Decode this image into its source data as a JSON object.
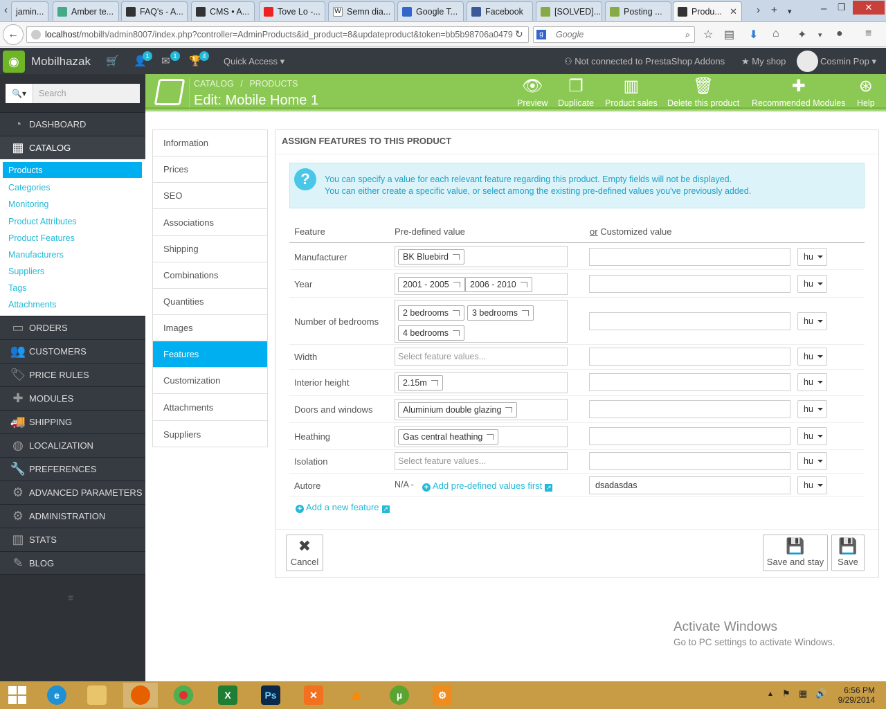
{
  "browser": {
    "tabs": [
      {
        "label": "jamin...",
        "color": "#7a8"
      },
      {
        "label": "Amber te...",
        "color": "#4a8"
      },
      {
        "label": "FAQ's - A...",
        "color": "#333"
      },
      {
        "label": "CMS • A...",
        "color": "#333"
      },
      {
        "label": "Tove Lo -...",
        "color": "#e22"
      },
      {
        "label": "Semn dia...",
        "color": "#111"
      },
      {
        "label": "Google T...",
        "color": "#36c"
      },
      {
        "label": "Facebook",
        "color": "#3b5998"
      },
      {
        "label": "[SOLVED]...",
        "color": "#8a4"
      },
      {
        "label": "Posting ...",
        "color": "#8a4"
      },
      {
        "label": "Produ...",
        "color": "#333"
      }
    ],
    "url_host": "localhost",
    "url_rest": "/mobilh/admin8007/index.php?controller=AdminProducts&id_product=8&updateproduct&token=bb5b98706a0479",
    "search_placeholder": "Google"
  },
  "header": {
    "shop_name": "Mobilhazak",
    "badges": [
      "1",
      "1",
      "4"
    ],
    "quick_access": "Quick Access",
    "addons_status": "Not connected to PrestaShop Addons",
    "my_shop": "My shop",
    "user_name": "Cosmin Pop"
  },
  "toolbar": {
    "breadcrumb_1": "CATALOG",
    "breadcrumb_sep": "/",
    "breadcrumb_2": "PRODUCTS",
    "title": "Edit: Mobile Home 1",
    "buttons": [
      "Preview",
      "Duplicate",
      "Product sales",
      "Delete this product",
      "Recommended Modules",
      "Help"
    ]
  },
  "sidebar": {
    "search_placeholder": "Search",
    "menu": [
      "DASHBOARD",
      "CATALOG",
      "ORDERS",
      "CUSTOMERS",
      "PRICE RULES",
      "MODULES",
      "SHIPPING",
      "LOCALIZATION",
      "PREFERENCES",
      "ADVANCED PARAMETERS",
      "ADMINISTRATION",
      "STATS",
      "BLOG"
    ],
    "catalog_sub": [
      "Products",
      "Categories",
      "Monitoring",
      "Product Attributes",
      "Product Features",
      "Manufacturers",
      "Suppliers",
      "Tags",
      "Attachments"
    ]
  },
  "tabs": [
    "Information",
    "Prices",
    "SEO",
    "Associations",
    "Shipping",
    "Combinations",
    "Quantities",
    "Images",
    "Features",
    "Customization",
    "Attachments",
    "Suppliers"
  ],
  "panel": {
    "heading": "ASSIGN FEATURES TO THIS PRODUCT",
    "info_line1": "You can specify a value for each relevant feature regarding this product. Empty fields will not be displayed.",
    "info_line2": "You can either create a specific value, or select among the existing pre-defined values you've previously added.",
    "col_feature": "Feature",
    "col_predefined": "Pre-defined value",
    "col_or": "or",
    "col_custom": "Customized value",
    "select_placeholder": "Select feature values...",
    "lang": "hu",
    "features": [
      {
        "name": "Manufacturer",
        "chips": [
          "BK Bluebird"
        ],
        "custom": ""
      },
      {
        "name": "Year",
        "chips": [
          "2001 - 2005",
          "2006 - 2010"
        ],
        "custom": ""
      },
      {
        "name": "Number of bedrooms",
        "chips": [
          "2 bedrooms",
          "3 bedrooms",
          "4 bedrooms"
        ],
        "custom": ""
      },
      {
        "name": "Width",
        "chips": [],
        "custom": ""
      },
      {
        "name": "Interior height",
        "chips": [
          "2.15m"
        ],
        "custom": ""
      },
      {
        "name": "Doors and windows",
        "chips": [
          "Aluminium double glazing"
        ],
        "custom": ""
      },
      {
        "name": "Heathing",
        "chips": [
          "Gas central heathing"
        ],
        "custom": ""
      },
      {
        "name": "Isolation",
        "chips": [],
        "custom": ""
      },
      {
        "name": "Autore",
        "chips": [],
        "custom": "dsadasdas"
      }
    ],
    "na_label": "N/A -",
    "add_predefined": "Add pre-defined values first",
    "add_feature": "Add a new feature",
    "cancel": "Cancel",
    "save_stay": "Save and stay",
    "save": "Save"
  },
  "watermark": {
    "title": "Activate Windows",
    "subtitle": "Go to PC settings to activate Windows."
  },
  "taskbar": {
    "time": "6:56 PM",
    "date": "9/29/2014"
  }
}
